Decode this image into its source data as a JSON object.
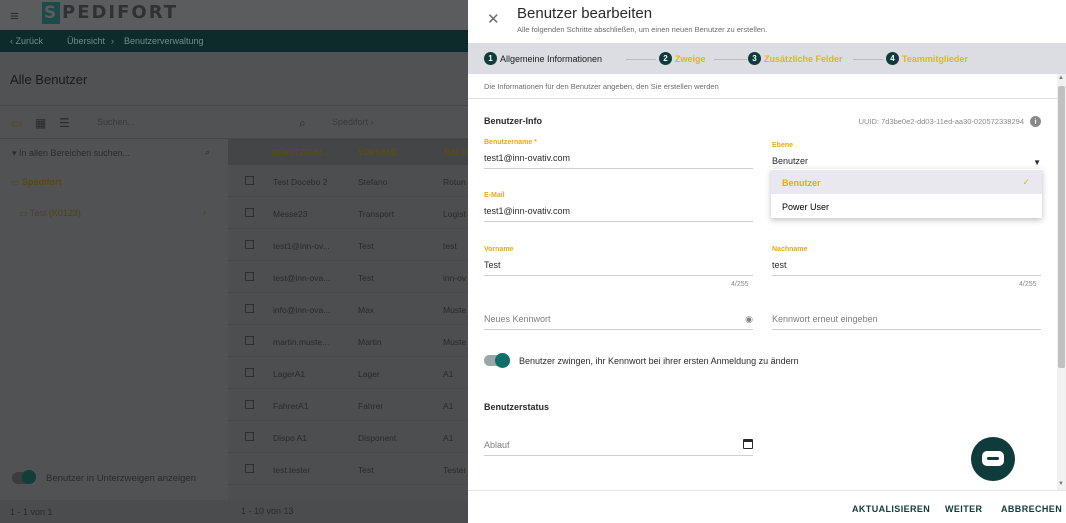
{
  "background": {
    "logo": "PEDIFORT",
    "logo_letter": "S",
    "nav": {
      "back": "‹ Zurück",
      "crumb1": "Übersicht",
      "sep": "›",
      "crumb2": "Benutzerverwaltung"
    },
    "title": "Alle Benutzer",
    "search_placeholder": "Suchen...",
    "org_filter": "Spedifort ›",
    "tree_search": "In allen Bereichen suchen...",
    "tree": [
      {
        "label": "Spedifort"
      },
      {
        "label": "Test (K0123)"
      }
    ],
    "table_headers": [
      "BENUTZERN...",
      "VORNAME",
      "NACHN"
    ],
    "rows": [
      [
        "Test Docebo 2",
        "Stefano",
        "Rotun"
      ],
      [
        "Messe23",
        "Transport",
        "Logist"
      ],
      [
        "test1@inn-ov...",
        "Test",
        "test"
      ],
      [
        "test@inn-ova...",
        "Test",
        "inn-ov"
      ],
      [
        "info@inn-ova...",
        "Max",
        "Muste"
      ],
      [
        "martin.muste...",
        "Martin",
        "Muste"
      ],
      [
        "LagerA1",
        "Lager",
        "A1"
      ],
      [
        "FahrerA1",
        "Fahrer",
        "A1"
      ],
      [
        "Dispo A1",
        "Disponent",
        "A1"
      ],
      [
        "test.tester",
        "Test",
        "Tester"
      ]
    ],
    "toggle_label": "Benutzer in Unterzweigen anzeigen",
    "footer_left": "1 - 1 von 1",
    "footer_right": "1 - 10 von 13"
  },
  "panel": {
    "title": "Benutzer bearbeiten",
    "subtitle": "Alle folgenden Schritte abschließen, um einen neuen Benutzer zu erstellen.",
    "steps": [
      {
        "num": "1",
        "label": "Allgemeine Informationen",
        "state": "active"
      },
      {
        "num": "2",
        "label": "Zweige",
        "state": "pending"
      },
      {
        "num": "3",
        "label": "Zusätzliche Felder",
        "state": "pending"
      },
      {
        "num": "4",
        "label": "Teammitglieder",
        "state": "pending"
      }
    ],
    "intro": "Die Informationen für den Benutzer angeben, den Sie erstellen werden",
    "section_info": "Benutzer-Info",
    "uuid": "UUID: 7d3be0e2-dd03-11ed-aa30-020572338294",
    "username": {
      "label": "Benutzername *",
      "value": "test1@inn-ovativ.com"
    },
    "level": {
      "label": "Ebene",
      "value": "Benutzer",
      "options": [
        "Benutzer",
        "Power User"
      ],
      "selected": "Benutzer"
    },
    "email": {
      "label": "E-Mail",
      "value": "test1@inn-ovativ.com"
    },
    "firstname": {
      "label": "Vorname",
      "value": "Test",
      "counter": "4/255"
    },
    "lastname": {
      "label": "Nachname",
      "value": "test",
      "counter": "4/255"
    },
    "new_password": {
      "placeholder": "Neues Kennwort"
    },
    "confirm_password": {
      "placeholder": "Kennwort erneut eingeben"
    },
    "force_change": {
      "label": "Benutzer zwingen, ihr Kennwort bei ihrer ersten Anmeldung zu ändern",
      "on": true
    },
    "section_status": "Benutzerstatus",
    "expiry": {
      "placeholder": "Ablauf"
    },
    "buttons": {
      "update": "AKTUALISIEREN",
      "next": "WEITER",
      "cancel": "ABBRECHEN"
    }
  }
}
